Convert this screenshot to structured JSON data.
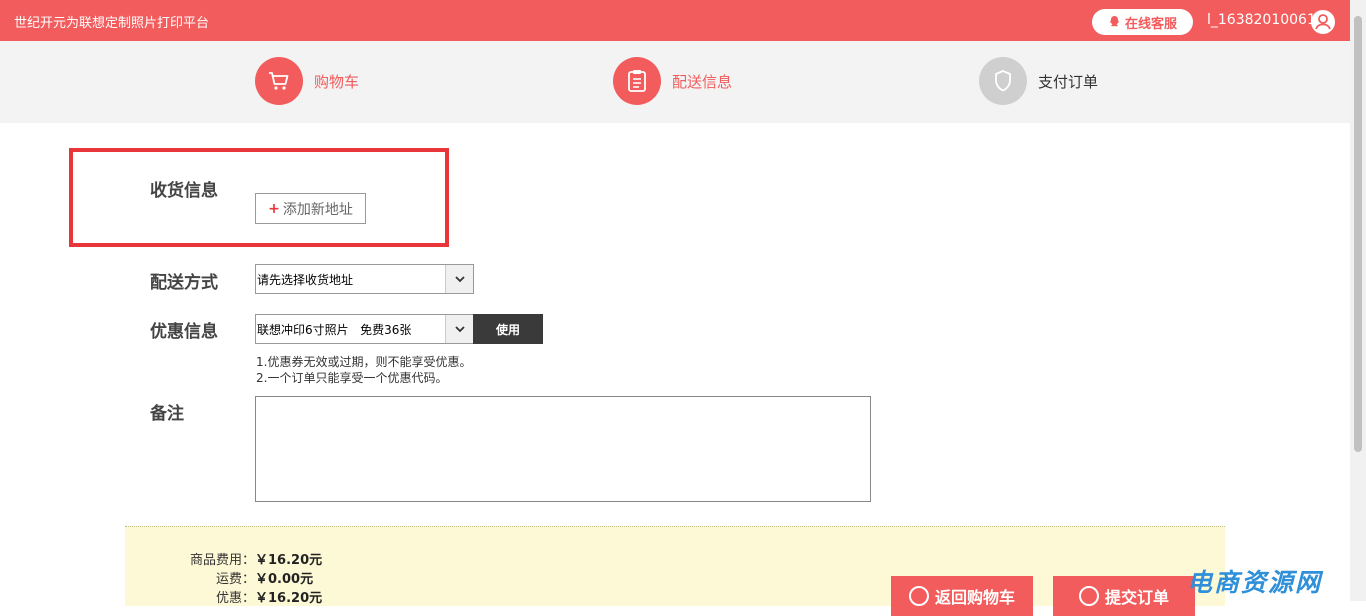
{
  "header": {
    "site_title": "世纪开元为联想定制照片打印平台",
    "service_label": "在线客服",
    "username": "l_16382010061"
  },
  "steps": [
    {
      "label": "购物车",
      "icon": "cart-icon",
      "state": "active"
    },
    {
      "label": "配送信息",
      "icon": "clipboard-icon",
      "state": "active"
    },
    {
      "label": "支付订单",
      "icon": "shield-icon",
      "state": "inactive"
    }
  ],
  "form": {
    "receiver_label": "收货信息",
    "add_address_label": "添加新地址",
    "delivery_label": "配送方式",
    "delivery_value": "请先选择收货地址",
    "coupon_label": "优惠信息",
    "coupon_value": "联想冲印6寸照片   免费36张",
    "use_label": "使用",
    "coupon_notes": [
      "1.优惠券无效或过期，则不能享受优惠。",
      "2.一个订单只能享受一个优惠代码。"
    ],
    "remark_label": "备注",
    "remark_value": ""
  },
  "summary": {
    "goods_fee_label": "商品费用：",
    "goods_fee_value": "￥16.20元",
    "shipping_label": "运费：",
    "shipping_value": "￥0.00元",
    "discount_label": "优惠：",
    "discount_value": "￥16.20元"
  },
  "actions": {
    "back_label": "返回购物车",
    "submit_label": "提交订单"
  },
  "watermark": "电商资源网",
  "colors": {
    "brand": "#f25c5c",
    "highlight_box": "#e8353a",
    "summary_bg": "#fdf9d6",
    "watermark": "#2f8fd8"
  }
}
